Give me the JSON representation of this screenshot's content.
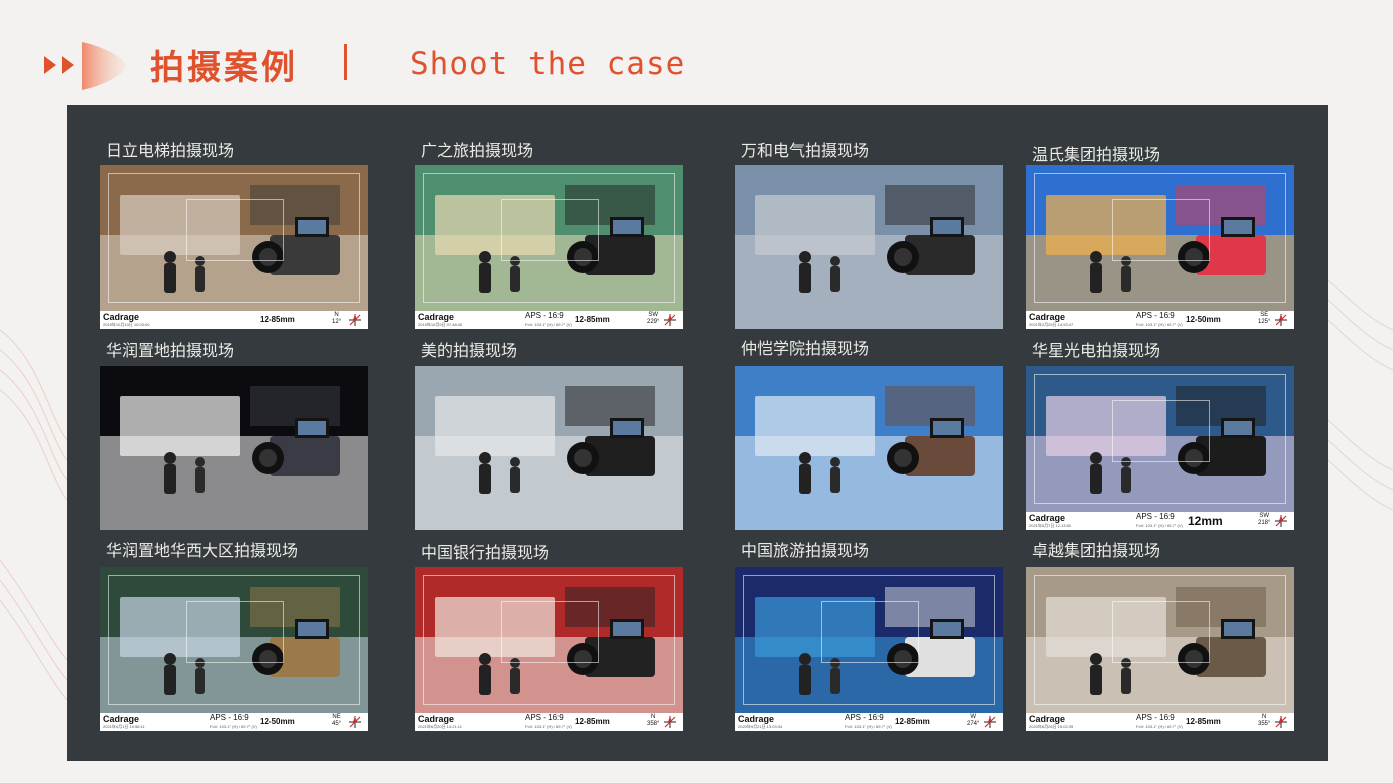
{
  "header": {
    "title_cn": "拍摄案例",
    "separator": "|",
    "title_en": "Shoot the case"
  },
  "colors": {
    "accent": "#e0512e",
    "panel": "#343a3d",
    "label": "#eceae6"
  },
  "cases": [
    {
      "label": "日立电梯拍摄现场",
      "cadrage": "Cadrage",
      "date": "2019年10月10日 10:03:00",
      "aps": "",
      "fov": "",
      "lens": "12-85mm",
      "dir": "N",
      "deg": "12°"
    },
    {
      "label": "广之旅拍摄现场",
      "cadrage": "Cadrage",
      "date": "2019年10月9日 07:48:40",
      "aps": "APS - 16:9",
      "fov": "FoV: 103.1° (H) / 69.7° (V)",
      "lens": "12-85mm",
      "dir": "SW",
      "deg": "229°"
    },
    {
      "label": "万和电气拍摄现场",
      "cadrage": "",
      "date": "",
      "aps": "",
      "fov": "",
      "lens": "",
      "dir": "",
      "deg": ""
    },
    {
      "label": "温氏集团拍摄现场",
      "cadrage": "Cadrage",
      "date": "2021年2月25日 14:53:47",
      "aps": "APS - 16:9",
      "fov": "FoV: 103.1° (H) / 69.7° (V)",
      "lens": "12-50mm",
      "dir": "SE",
      "deg": "125°"
    },
    {
      "label": "华润置地拍摄现场",
      "cadrage": "",
      "date": "",
      "aps": "",
      "fov": "",
      "lens": "",
      "dir": "",
      "deg": ""
    },
    {
      "label": "美的拍摄现场",
      "cadrage": "",
      "date": "",
      "aps": "",
      "fov": "",
      "lens": "",
      "dir": "",
      "deg": ""
    },
    {
      "label": "仲恺学院拍摄现场",
      "cadrage": "",
      "date": "",
      "aps": "",
      "fov": "",
      "lens": "",
      "dir": "",
      "deg": ""
    },
    {
      "label": "华星光电拍摄现场",
      "cadrage": "Cadrage",
      "date": "2021年5月7日 12:13:50",
      "aps": "APS - 16:9",
      "fov": "FoV: 103.1° (H) / 69.7° (V)",
      "lens": "12mm",
      "dir": "SW",
      "deg": "218°"
    },
    {
      "label": "华润置地华西大区拍摄现场",
      "cadrage": "Cadrage",
      "date": "2021年4月1日 19:58:11",
      "aps": "APS - 16:9",
      "fov": "FoV: 103.1° (H) / 69.7° (V)",
      "lens": "12-50mm",
      "dir": "NE",
      "deg": "45°"
    },
    {
      "label": "中国银行拍摄现场",
      "cadrage": "Cadrage",
      "date": "2021年6月20日 14:21:11",
      "aps": "APS - 16:9",
      "fov": "FoV: 103.1° (H) / 69.7° (V)",
      "lens": "12-85mm",
      "dir": "N",
      "deg": "358°"
    },
    {
      "label": "中国旅游拍摄现场",
      "cadrage": "Cadrage",
      "date": "2020年9月21日 13:03:34",
      "aps": "APS - 16:9",
      "fov": "FoV: 103.1° (H) / 69.7° (V)",
      "lens": "12-85mm",
      "dir": "W",
      "deg": "274°"
    },
    {
      "label": "卓越集团拍摄现场",
      "cadrage": "Cadrage",
      "date": "2020年8月26日 15:02:39",
      "aps": "APS - 16:9",
      "fov": "FoV: 103.1° (H) / 69.7° (V)",
      "lens": "12-85mm",
      "dir": "N",
      "deg": "355°"
    }
  ]
}
